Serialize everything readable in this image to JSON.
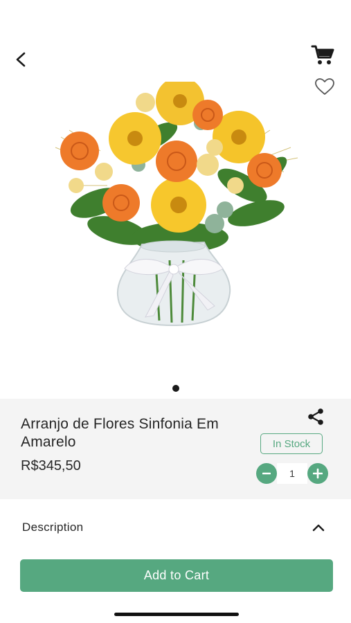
{
  "header": {
    "back_icon": "chevron-left-icon",
    "cart_icon": "shopping-cart-icon",
    "favorite_icon": "heart-outline-icon"
  },
  "carousel": {
    "image_subject": "yellow gerberas and orange roses in glass vase with white ribbon",
    "total_slides": 1,
    "active_slide": 1
  },
  "product": {
    "title": "Arranjo de Flores Sinfonia Em Amarelo",
    "price": "R$345,50",
    "stock_status": "In Stock",
    "quantity": "1",
    "share_icon": "share-icon"
  },
  "description": {
    "label": "Description",
    "toggle_icon": "chevron-up-icon",
    "expanded": true
  },
  "actions": {
    "add_to_cart_label": "Add to Cart"
  },
  "colors": {
    "accent": "#56a880",
    "panel_bg": "#f4f4f4",
    "text": "#262626"
  }
}
